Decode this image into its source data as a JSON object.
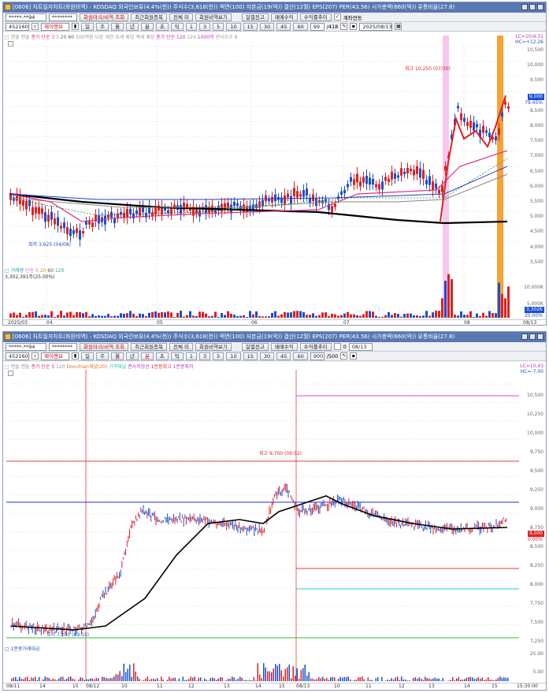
{
  "top": {
    "title": "[0606] 차트일자차트(화원비역) - KOSDAQ 외국인보유(4.4%(천)) 주식수(3,618(천)) 액면(100) 자본금(19(억)) 결산(12월) EPS(207) PER(43.56) 시가총액(660(억)) 유통비율(27.8)",
    "code": "452160",
    "name": "제이엔브",
    "stock_input": "*****-**94",
    "pw": "********",
    "btn_query": "화원마크/비역 조회",
    "btn_recent": "최근회원종목",
    "btn_all": "전체 미",
    "btn_trend": "회원비역보기",
    "btn_day": "일별전고",
    "btn_trade": "매매수익",
    "btn_rate": "수익률추이",
    "btn_continue": "계좌연동",
    "periods": [
      "일",
      "주",
      "월",
      "년",
      "분",
      "초",
      "틱"
    ],
    "nums": [
      "1",
      "3",
      "5",
      "10",
      "15",
      "30",
      "45",
      "60"
    ],
    "count": "99",
    "count2": "/418",
    "date": "2025/08/13",
    "legend": {
      "a": "□ 캔들 캔들 ",
      "b": "종가 단순 3",
      "c": "5",
      "d": "20",
      "e": "60",
      "f": "500억원 다른 세전 요세 패업",
      "g": "액세 패업",
      "h": "종가 단순 120",
      "i": "224",
      "j": "1000억",
      "k": "권사오수",
      "l": "8"
    },
    "vol_legend": "□ 거래량 ",
    "vol_ma": "단순 5",
    "vol_ma2": "20",
    "vol_ma3": "60",
    "vol_ma4": "120",
    "vol_value": "3,302,391주(25.00%)",
    "high_label": "최고 10,250 (07/30)",
    "low_label": "최저 3,925 (04/08)",
    "axis": [
      "10,500",
      "10,000",
      "9,500",
      "9,000",
      "8,500",
      "8,000",
      "7,500",
      "7,000",
      "6,500",
      "6,000",
      "5,500",
      "5,000",
      "4,500",
      "4,000",
      "3,500"
    ],
    "axis_top": "LC=10/4.31",
    "axis_top2": "HC=+12.26",
    "price_badge": "9,000",
    "price_badge2": "79.45%",
    "vol_axis": [
      "10,000K",
      "5,000K"
    ],
    "vol_badge": "3,302K",
    "vol_badge2": "25.00%",
    "xlabels": [
      "2025/03",
      "04",
      "05",
      "06",
      "07",
      "08",
      "08/13"
    ]
  },
  "bottom": {
    "title": "[0606] 차트일자차트(화원비역) - KOSDAQ 외국인보유(4.4%(천)) 주식수(3,618(천)) 액면(100) 자본금(19(억)) 결산(12월) EPS(207) PER(43.56) 시가총액(660(억)) 유통비율(27.8)",
    "code": "452160",
    "name": "제이엔브",
    "stock_input": "*****-**94",
    "pw": "********",
    "btn_query": "화원마크/비역 조회",
    "btn_recent": "최근회원종목",
    "btn_all": "전체 미",
    "btn_trend": "회원비역보기",
    "btn_day": "일별전고",
    "btn_trade": "매매수익",
    "btn_rate": "수익률추이",
    "btn_continue": "0",
    "date": "08/13",
    "count": "900",
    "count2": "/500",
    "legend": {
      "a": "□ 캔들 캔들 ",
      "b": "종가 단순 5",
      "c": "120",
      "d": "Donchian채널(20)",
      "e": "가격채널",
      "f": "권사저항선",
      "g": "1분봉최고",
      "h": "1분봉최저"
    },
    "vol_legend": "□ 1분봉거래대금",
    "high_label": "최고 9,700 (09:52)",
    "low_label": "최저 7,280 (09:03)",
    "axis": [
      "10,500",
      "10,250",
      "10,000",
      "9,750",
      "9,500",
      "9,250",
      "9,000",
      "8,750",
      "8,500",
      "8,250",
      "8,000",
      "7,750",
      "7,500",
      "7,250"
    ],
    "axis_top": "LC=10,43",
    "axis_top2": "HC=-7.00",
    "price_badge": "9,000",
    "price_badge2": "0.00%",
    "vol_axis": [
      "25.00",
      "5.00"
    ],
    "xlabels": [
      "08/11",
      "14",
      "15",
      "08/12",
      "10",
      "11",
      "12",
      "13",
      "14",
      "15",
      "08/13",
      "10",
      "11",
      "12",
      "13",
      "14",
      "15",
      "15:30:00"
    ]
  }
}
